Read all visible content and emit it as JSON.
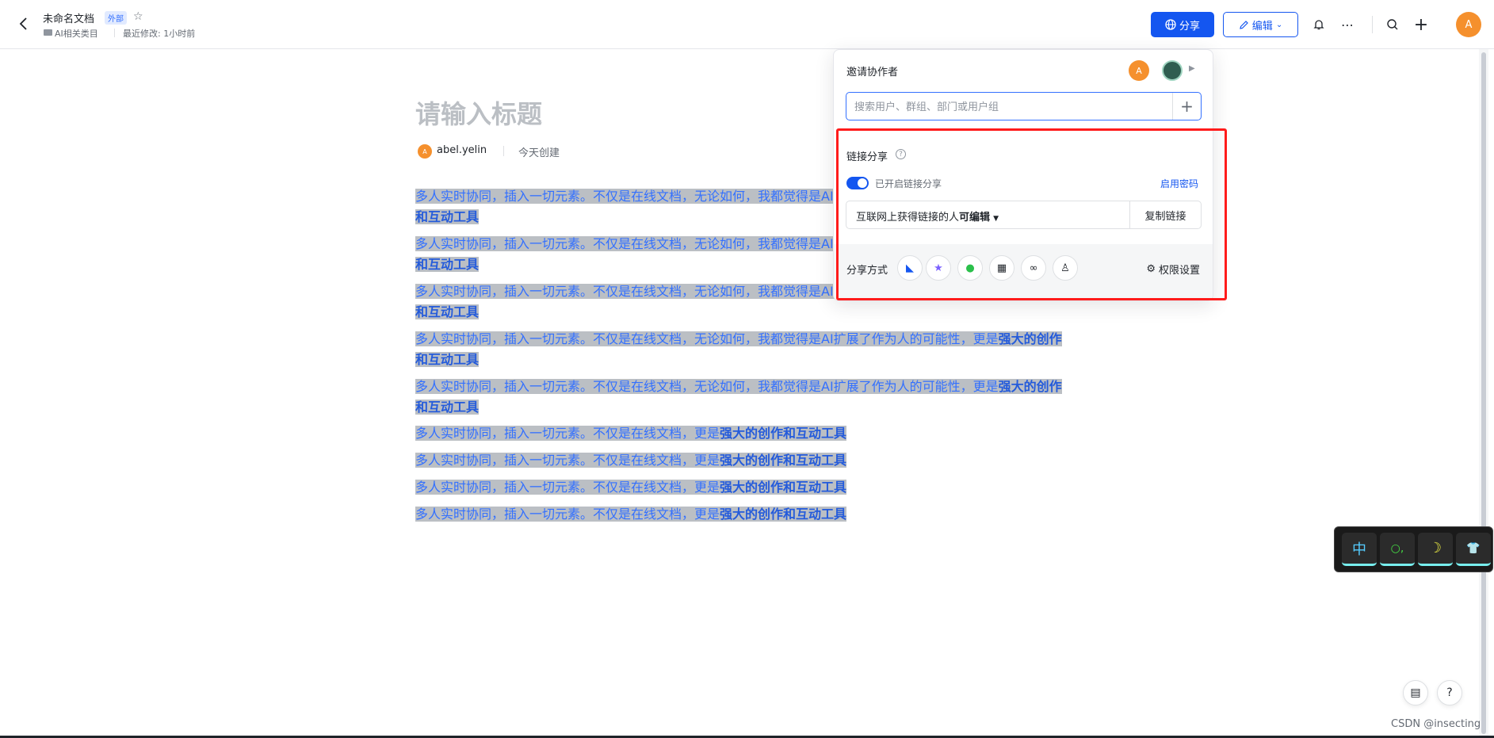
{
  "header": {
    "doc_title": "未命名文档",
    "tag": "外部",
    "breadcrumb": "AI相关类目",
    "modified": "最近修改: 1小时前",
    "share_label": "分享",
    "edit_label": "编辑",
    "avatar_letter": "A"
  },
  "doc": {
    "title_placeholder": "请输入标题",
    "author": "abel.yelin",
    "author_letter": "A",
    "created": "今天创建",
    "paragraphs": [
      {
        "normal": "多人实时协同，插入一切元素。不仅是在线文档，无论如何，我都觉得是AI扩展了作为人的可能性，更是",
        "bold": "强大的创作和互动工具"
      },
      {
        "normal": "多人实时协同，插入一切元素。不仅是在线文档，无论如何，我都觉得是AI扩展了作为人的可能性，更是",
        "bold": "强大的创作和互动工具"
      },
      {
        "normal": "多人实时协同，插入一切元素。不仅是在线文档，无论如何，我都觉得是AI扩展了作为人的可能性，更是",
        "bold": "强大的创作和互动工具"
      },
      {
        "normal": "多人实时协同，插入一切元素。不仅是在线文档，无论如何，我都觉得是AI扩展了作为人的可能性，更是",
        "bold": "强大的创作和互动工具"
      },
      {
        "normal": "多人实时协同，插入一切元素。不仅是在线文档，无论如何，我都觉得是AI扩展了作为人的可能性，更是",
        "bold": "强大的创作和互动工具"
      },
      {
        "normal": "多人实时协同，插入一切元素。不仅是在线文档，更是",
        "bold": "强大的创作和互动工具"
      },
      {
        "normal": "多人实时协同，插入一切元素。不仅是在线文档，更是",
        "bold": "强大的创作和互动工具"
      },
      {
        "normal": "多人实时协同，插入一切元素。不仅是在线文档，更是",
        "bold": "强大的创作和互动工具"
      },
      {
        "normal": "多人实时协同，插入一切元素。不仅是在线文档，更是",
        "bold": "强大的创作和互动工具"
      }
    ]
  },
  "share_panel": {
    "invite_label": "邀请协作者",
    "invite_avatar_letter": "A",
    "search_placeholder": "搜索用户、群组、部门或用户组",
    "link_share_title": "链接分享",
    "toggle_label": "已开启链接分享",
    "password_link": "启用密码",
    "permission_prefix": "互联网上获得链接的人",
    "permission_value": "可编辑",
    "copy_link": "复制链接",
    "share_way_label": "分享方式",
    "perm_settings": "权限设置"
  },
  "ime": {
    "keys": [
      "中",
      "○,",
      "☽",
      "👕"
    ]
  },
  "watermark": "CSDN @insecting"
}
